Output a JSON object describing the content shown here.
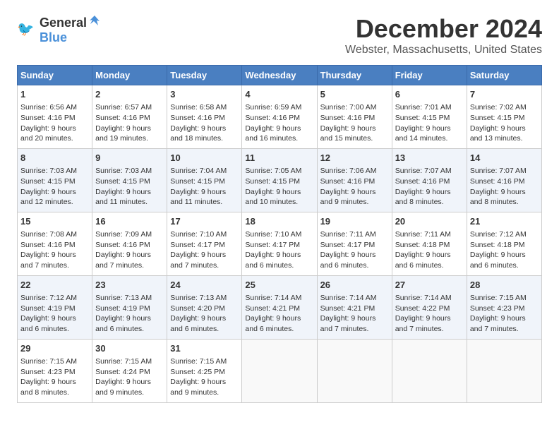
{
  "logo": {
    "general": "General",
    "blue": "Blue"
  },
  "title": "December 2024",
  "subtitle": "Webster, Massachusetts, United States",
  "days_of_week": [
    "Sunday",
    "Monday",
    "Tuesday",
    "Wednesday",
    "Thursday",
    "Friday",
    "Saturday"
  ],
  "weeks": [
    [
      {
        "day": "1",
        "sunrise": "6:56 AM",
        "sunset": "4:16 PM",
        "daylight_hours": "9 hours",
        "daylight_minutes": "and 20 minutes."
      },
      {
        "day": "2",
        "sunrise": "6:57 AM",
        "sunset": "4:16 PM",
        "daylight_hours": "9 hours",
        "daylight_minutes": "and 19 minutes."
      },
      {
        "day": "3",
        "sunrise": "6:58 AM",
        "sunset": "4:16 PM",
        "daylight_hours": "9 hours",
        "daylight_minutes": "and 18 minutes."
      },
      {
        "day": "4",
        "sunrise": "6:59 AM",
        "sunset": "4:16 PM",
        "daylight_hours": "9 hours",
        "daylight_minutes": "and 16 minutes."
      },
      {
        "day": "5",
        "sunrise": "7:00 AM",
        "sunset": "4:16 PM",
        "daylight_hours": "9 hours",
        "daylight_minutes": "and 15 minutes."
      },
      {
        "day": "6",
        "sunrise": "7:01 AM",
        "sunset": "4:15 PM",
        "daylight_hours": "9 hours",
        "daylight_minutes": "and 14 minutes."
      },
      {
        "day": "7",
        "sunrise": "7:02 AM",
        "sunset": "4:15 PM",
        "daylight_hours": "9 hours",
        "daylight_minutes": "and 13 minutes."
      }
    ],
    [
      {
        "day": "8",
        "sunrise": "7:03 AM",
        "sunset": "4:15 PM",
        "daylight_hours": "9 hours",
        "daylight_minutes": "and 12 minutes."
      },
      {
        "day": "9",
        "sunrise": "7:03 AM",
        "sunset": "4:15 PM",
        "daylight_hours": "9 hours",
        "daylight_minutes": "and 11 minutes."
      },
      {
        "day": "10",
        "sunrise": "7:04 AM",
        "sunset": "4:15 PM",
        "daylight_hours": "9 hours",
        "daylight_minutes": "and 11 minutes."
      },
      {
        "day": "11",
        "sunrise": "7:05 AM",
        "sunset": "4:15 PM",
        "daylight_hours": "9 hours",
        "daylight_minutes": "and 10 minutes."
      },
      {
        "day": "12",
        "sunrise": "7:06 AM",
        "sunset": "4:16 PM",
        "daylight_hours": "9 hours",
        "daylight_minutes": "and 9 minutes."
      },
      {
        "day": "13",
        "sunrise": "7:07 AM",
        "sunset": "4:16 PM",
        "daylight_hours": "9 hours",
        "daylight_minutes": "and 8 minutes."
      },
      {
        "day": "14",
        "sunrise": "7:07 AM",
        "sunset": "4:16 PM",
        "daylight_hours": "9 hours",
        "daylight_minutes": "and 8 minutes."
      }
    ],
    [
      {
        "day": "15",
        "sunrise": "7:08 AM",
        "sunset": "4:16 PM",
        "daylight_hours": "9 hours",
        "daylight_minutes": "and 7 minutes."
      },
      {
        "day": "16",
        "sunrise": "7:09 AM",
        "sunset": "4:16 PM",
        "daylight_hours": "9 hours",
        "daylight_minutes": "and 7 minutes."
      },
      {
        "day": "17",
        "sunrise": "7:10 AM",
        "sunset": "4:17 PM",
        "daylight_hours": "9 hours",
        "daylight_minutes": "and 7 minutes."
      },
      {
        "day": "18",
        "sunrise": "7:10 AM",
        "sunset": "4:17 PM",
        "daylight_hours": "9 hours",
        "daylight_minutes": "and 6 minutes."
      },
      {
        "day": "19",
        "sunrise": "7:11 AM",
        "sunset": "4:17 PM",
        "daylight_hours": "9 hours",
        "daylight_minutes": "and 6 minutes."
      },
      {
        "day": "20",
        "sunrise": "7:11 AM",
        "sunset": "4:18 PM",
        "daylight_hours": "9 hours",
        "daylight_minutes": "and 6 minutes."
      },
      {
        "day": "21",
        "sunrise": "7:12 AM",
        "sunset": "4:18 PM",
        "daylight_hours": "9 hours",
        "daylight_minutes": "and 6 minutes."
      }
    ],
    [
      {
        "day": "22",
        "sunrise": "7:12 AM",
        "sunset": "4:19 PM",
        "daylight_hours": "9 hours",
        "daylight_minutes": "and 6 minutes."
      },
      {
        "day": "23",
        "sunrise": "7:13 AM",
        "sunset": "4:19 PM",
        "daylight_hours": "9 hours",
        "daylight_minutes": "and 6 minutes."
      },
      {
        "day": "24",
        "sunrise": "7:13 AM",
        "sunset": "4:20 PM",
        "daylight_hours": "9 hours",
        "daylight_minutes": "and 6 minutes."
      },
      {
        "day": "25",
        "sunrise": "7:14 AM",
        "sunset": "4:21 PM",
        "daylight_hours": "9 hours",
        "daylight_minutes": "and 6 minutes."
      },
      {
        "day": "26",
        "sunrise": "7:14 AM",
        "sunset": "4:21 PM",
        "daylight_hours": "9 hours",
        "daylight_minutes": "and 7 minutes."
      },
      {
        "day": "27",
        "sunrise": "7:14 AM",
        "sunset": "4:22 PM",
        "daylight_hours": "9 hours",
        "daylight_minutes": "and 7 minutes."
      },
      {
        "day": "28",
        "sunrise": "7:15 AM",
        "sunset": "4:23 PM",
        "daylight_hours": "9 hours",
        "daylight_minutes": "and 7 minutes."
      }
    ],
    [
      {
        "day": "29",
        "sunrise": "7:15 AM",
        "sunset": "4:23 PM",
        "daylight_hours": "9 hours",
        "daylight_minutes": "and 8 minutes."
      },
      {
        "day": "30",
        "sunrise": "7:15 AM",
        "sunset": "4:24 PM",
        "daylight_hours": "9 hours",
        "daylight_minutes": "and 9 minutes."
      },
      {
        "day": "31",
        "sunrise": "7:15 AM",
        "sunset": "4:25 PM",
        "daylight_hours": "9 hours",
        "daylight_minutes": "and 9 minutes."
      },
      null,
      null,
      null,
      null
    ]
  ],
  "labels": {
    "sunrise": "Sunrise:",
    "sunset": "Sunset:",
    "daylight": "Daylight:"
  }
}
